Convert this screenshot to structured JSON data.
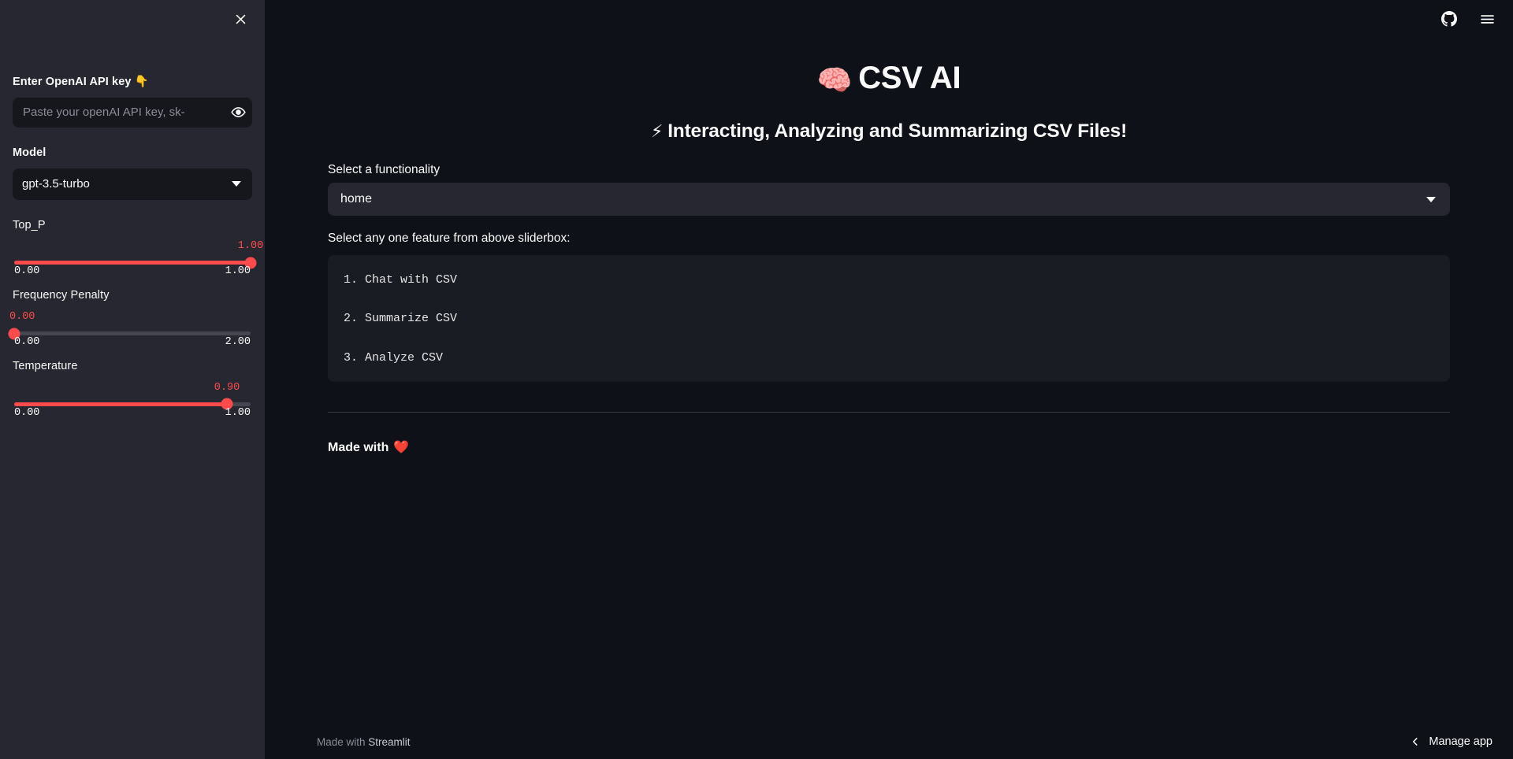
{
  "sidebar": {
    "close_icon": "close-icon",
    "api_key": {
      "label": "Enter OpenAI API key",
      "label_emoji": "👇",
      "placeholder": "Paste your openAI API key, sk-",
      "value": "",
      "reveal_icon": "eye-icon"
    },
    "model": {
      "label": "Model",
      "value": "gpt-3.5-turbo",
      "caret_icon": "chevron-down-icon"
    },
    "sliders": [
      {
        "label": "Top_P",
        "value": "1.00",
        "min": "0.00",
        "max": "1.00",
        "percent": 100
      },
      {
        "label": "Frequency Penalty",
        "value": "0.00",
        "min": "0.00",
        "max": "2.00",
        "percent": 0
      },
      {
        "label": "Temperature",
        "value": "0.90",
        "min": "0.00",
        "max": "1.00",
        "percent": 90
      }
    ]
  },
  "header": {
    "github_icon": "github-icon",
    "menu_icon": "hamburger-menu-icon"
  },
  "main": {
    "title_emoji": "🧠",
    "title": "CSV AI",
    "subtitle_emoji": "⚡",
    "subtitle": "Interacting, Analyzing and Summarizing CSV Files!",
    "functionality": {
      "label": "Select a functionality",
      "value": "home",
      "caret_icon": "chevron-down-icon"
    },
    "feature_prompt": "Select any one feature from above sliderbox:",
    "features": [
      "1. Chat with CSV",
      "2. Summarize CSV",
      "3. Analyze CSV"
    ],
    "made_with_label": "Made with",
    "made_with_emoji": "❤️"
  },
  "footer": {
    "made_with_prefix": "Made with ",
    "made_with_brand": "Streamlit",
    "manage_app_label": "Manage app",
    "back_icon": "chevron-left-icon"
  },
  "colors": {
    "accent": "#ff4b4b",
    "sidebar_bg": "#262730",
    "main_bg": "#0e1117",
    "input_bg": "#16171d",
    "code_bg": "#1a1c24",
    "text": "#fafafa"
  }
}
